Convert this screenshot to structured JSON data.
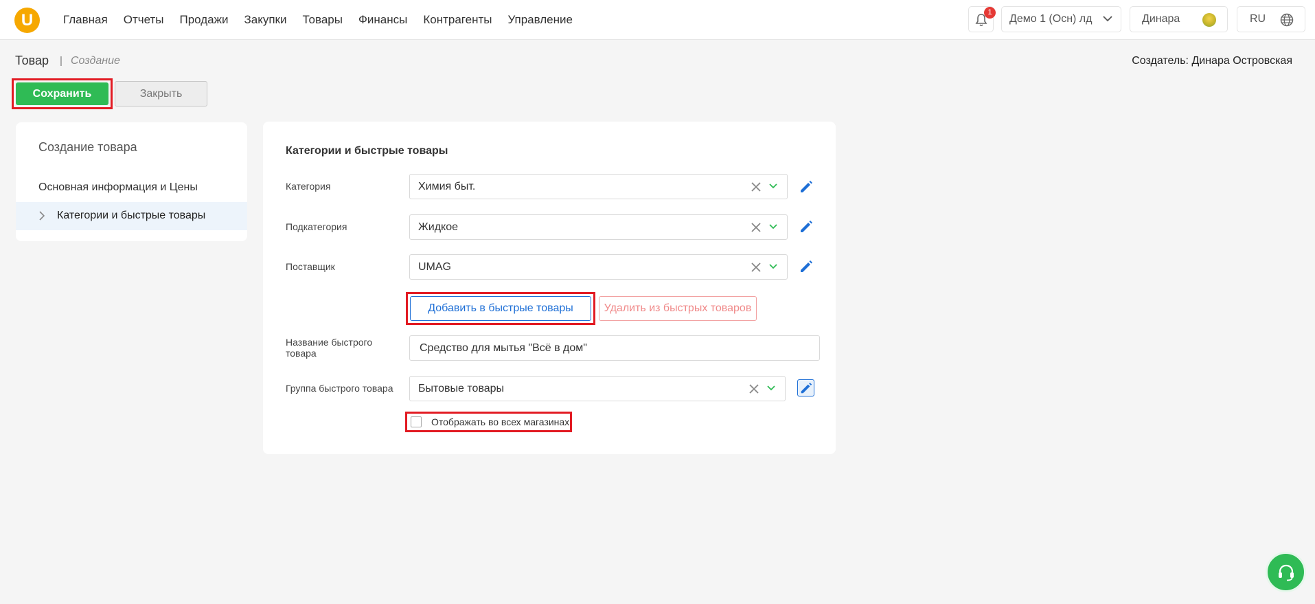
{
  "header": {
    "logo_text": "U",
    "nav": [
      "Главная",
      "Отчеты",
      "Продажи",
      "Закупки",
      "Товары",
      "Финансы",
      "Контрагенты",
      "Управление"
    ],
    "notifications_count": "1",
    "store": "Демо 1 (Осн) лд",
    "user": "Динара",
    "lang": "RU"
  },
  "page": {
    "title": "Товар",
    "separator": "|",
    "subtitle": "Создание",
    "creator": "Создатель: Динара Островская"
  },
  "actions": {
    "save_label": "Сохранить",
    "close_label": "Закрыть"
  },
  "sidebar": {
    "title": "Создание товара",
    "items": [
      {
        "label": "Основная информация и Цены"
      },
      {
        "label": "Категории и быстрые товары"
      }
    ]
  },
  "form": {
    "section_title": "Категории и быстрые товары",
    "category_label": "Категория",
    "category_value": "Химия быт.",
    "subcategory_label": "Подкатегория",
    "subcategory_value": "Жидкое",
    "supplier_label": "Поставщик",
    "supplier_value": "UMAG",
    "add_quick_label": "Добавить в быстрые товары",
    "remove_quick_label": "Удалить из быстрых товаров",
    "quick_name_label": "Название быстрого товара",
    "quick_name_value": "Средство для мытья \"Всё в дом\"",
    "quick_group_label": "Группа быстрого товара",
    "quick_group_value": "Бытовые товары",
    "show_all_stores_label": "Отображать во всех магазинах"
  },
  "colors": {
    "brand": "#f6a800",
    "save": "#2fbb55",
    "accent": "#1e6fd6",
    "highlight": "#e21b23"
  }
}
